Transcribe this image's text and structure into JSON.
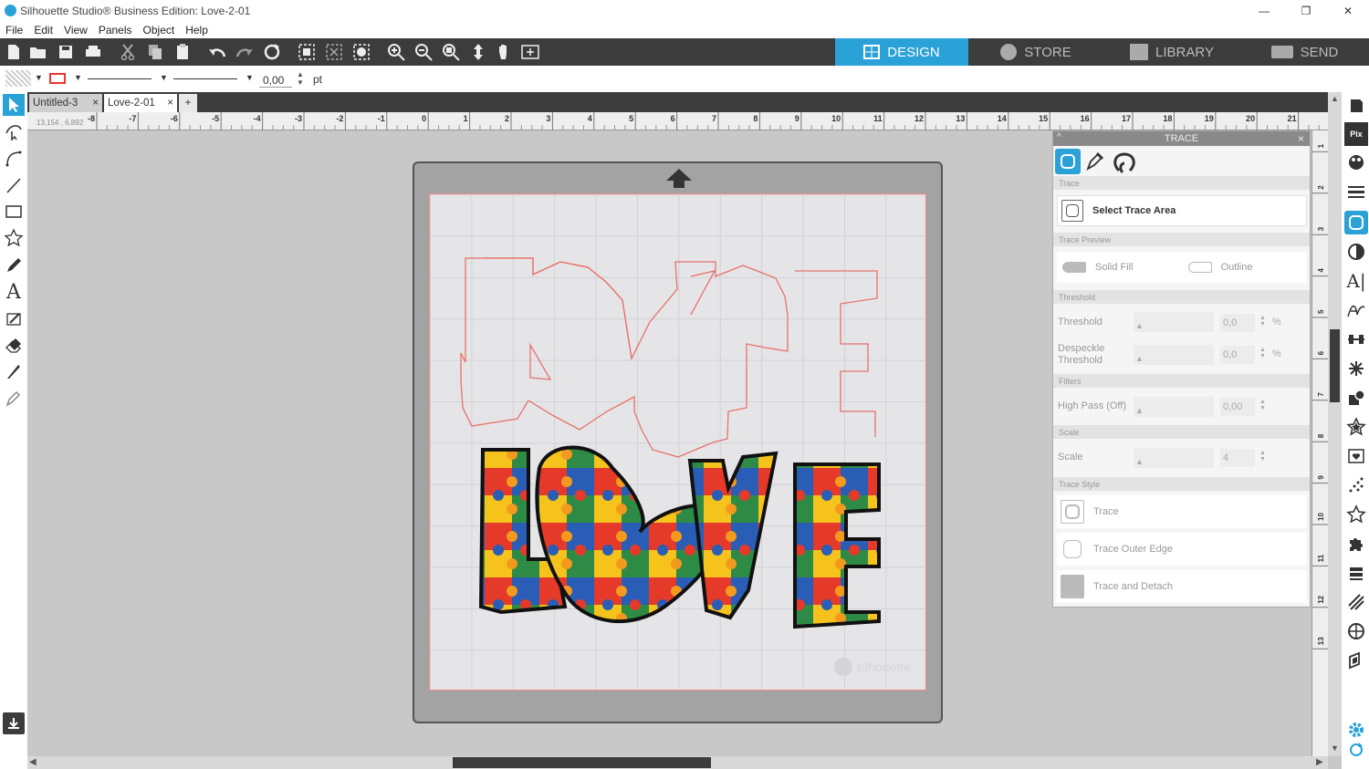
{
  "window": {
    "title": "Silhouette Studio® Business Edition: Love-2-01",
    "minimize": "—",
    "maximize": "❐",
    "close": "✕"
  },
  "menu": [
    "File",
    "Edit",
    "View",
    "Panels",
    "Object",
    "Help"
  ],
  "nav_tabs": [
    {
      "label": "DESIGN",
      "active": true
    },
    {
      "label": "STORE",
      "active": false
    },
    {
      "label": "LIBRARY",
      "active": false
    },
    {
      "label": "SEND",
      "active": false
    }
  ],
  "props": {
    "line_width": "0,00",
    "unit": "pt"
  },
  "doc_tabs": [
    {
      "label": "Untitled-3",
      "close": "×"
    },
    {
      "label": "Love-2-01",
      "close": "×"
    }
  ],
  "add_tab": "+",
  "ruler": {
    "h_ticks": [
      "-8",
      "-7",
      "-6",
      "-5",
      "-4",
      "-3",
      "-2",
      "-1",
      "0",
      "1",
      "2",
      "3",
      "4",
      "5",
      "6",
      "7",
      "8",
      "9",
      "10",
      "11",
      "12",
      "13",
      "14",
      "15",
      "16",
      "17",
      "18",
      "19",
      "20",
      "21"
    ],
    "v_ticks": [
      "1",
      "2",
      "3",
      "4",
      "5",
      "6",
      "7",
      "8",
      "9",
      "10",
      "11",
      "12",
      "13"
    ],
    "coords": "13,154 , 6,892"
  },
  "canvas": {
    "watermark": "silhouette"
  },
  "trace_panel": {
    "title": "TRACE",
    "close": "×",
    "sec_trace": "Trace",
    "select_area": "Select Trace Area",
    "sec_preview": "Trace Preview",
    "solid_fill": "Solid Fill",
    "outline": "Outline",
    "sec_threshold": "Threshold",
    "threshold_label": "Threshold",
    "threshold_value": "0,0",
    "threshold_unit": "%",
    "despeckle_label_1": "Despeckle",
    "despeckle_label_2": "Threshold",
    "despeckle_value": "0,0",
    "despeckle_unit": "%",
    "sec_filters": "Filters",
    "highpass_label": "High Pass (Off)",
    "highpass_value": "0,00",
    "sec_scale": "Scale",
    "scale_label": "Scale",
    "scale_value": "4",
    "sec_style": "Trace Style",
    "trace": "Trace",
    "trace_outer": "Trace Outer Edge",
    "trace_detach": "Trace and Detach"
  },
  "colors": {
    "accent": "#2aa2d8",
    "toolbar": "#3c3c3c",
    "trace_line": "#e8706a"
  }
}
